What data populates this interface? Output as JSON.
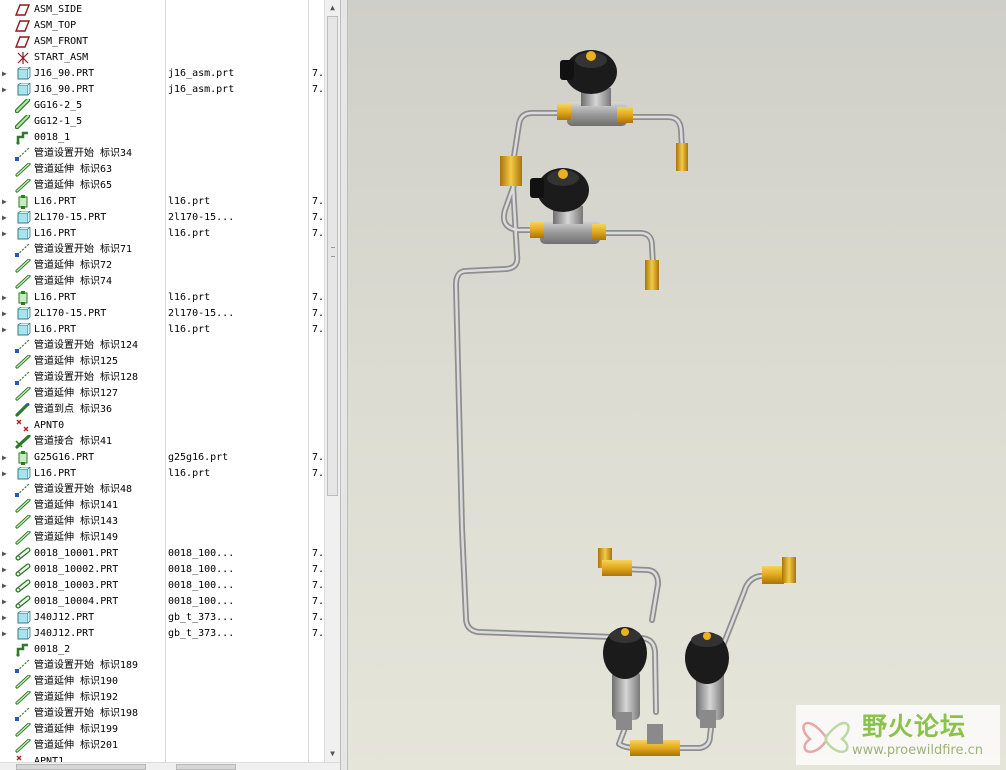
{
  "model_tree": {
    "rows": [
      {
        "name": "ASM_SIDE",
        "file": "",
        "col3": "",
        "icon": "datum-plane-icon",
        "expandable": false
      },
      {
        "name": "ASM_TOP",
        "file": "",
        "col3": "",
        "icon": "datum-plane-icon",
        "expandable": false
      },
      {
        "name": "ASM_FRONT",
        "file": "",
        "col3": "",
        "icon": "datum-plane-icon",
        "expandable": false
      },
      {
        "name": "START_ASM",
        "file": "",
        "col3": "",
        "icon": "coordinate-system-icon",
        "expandable": false
      },
      {
        "name": "J16_90.PRT",
        "file": "j16_asm.prt",
        "col3": "7.",
        "icon": "part-icon",
        "expandable": true
      },
      {
        "name": "J16_90.PRT",
        "file": "j16_asm.prt",
        "col3": "7.",
        "icon": "part-icon",
        "expandable": true
      },
      {
        "name": "GG16-2_5",
        "file": "",
        "col3": "",
        "icon": "pipe-segment-icon",
        "expandable": false
      },
      {
        "name": "GG12-1_5",
        "file": "",
        "col3": "",
        "icon": "pipe-segment-icon",
        "expandable": false
      },
      {
        "name": "0018_1",
        "file": "",
        "col3": "",
        "icon": "pipeline-icon",
        "expandable": false
      },
      {
        "name": "管道设置开始 标识34",
        "file": "",
        "col3": "",
        "icon": "pipe-start-icon",
        "expandable": false
      },
      {
        "name": "管道延伸 标识63",
        "file": "",
        "col3": "",
        "icon": "pipe-extend-icon",
        "expandable": false
      },
      {
        "name": "管道延伸 标识65",
        "file": "",
        "col3": "",
        "icon": "pipe-extend-icon",
        "expandable": false
      },
      {
        "name": "L16.PRT",
        "file": "l16.prt",
        "col3": "7.",
        "icon": "fitting-part-icon",
        "expandable": true
      },
      {
        "name": "2L170-15.PRT",
        "file": "2l170-15...",
        "col3": "7.",
        "icon": "part-icon",
        "expandable": true
      },
      {
        "name": "L16.PRT",
        "file": "l16.prt",
        "col3": "7.",
        "icon": "part-icon",
        "expandable": true
      },
      {
        "name": "管道设置开始 标识71",
        "file": "",
        "col3": "",
        "icon": "pipe-start-icon",
        "expandable": false
      },
      {
        "name": "管道延伸 标识72",
        "file": "",
        "col3": "",
        "icon": "pipe-extend-icon",
        "expandable": false
      },
      {
        "name": "管道延伸 标识74",
        "file": "",
        "col3": "",
        "icon": "pipe-extend-icon",
        "expandable": false
      },
      {
        "name": "L16.PRT",
        "file": "l16.prt",
        "col3": "7.",
        "icon": "fitting-part-icon",
        "expandable": true
      },
      {
        "name": "2L170-15.PRT",
        "file": "2l170-15...",
        "col3": "7.",
        "icon": "part-icon",
        "expandable": true
      },
      {
        "name": "L16.PRT",
        "file": "l16.prt",
        "col3": "7.",
        "icon": "part-icon",
        "expandable": true
      },
      {
        "name": "管道设置开始 标识124",
        "file": "",
        "col3": "",
        "icon": "pipe-start-icon",
        "expandable": false
      },
      {
        "name": "管道延伸 标识125",
        "file": "",
        "col3": "",
        "icon": "pipe-extend-icon",
        "expandable": false
      },
      {
        "name": "管道设置开始 标识128",
        "file": "",
        "col3": "",
        "icon": "pipe-start-icon",
        "expandable": false
      },
      {
        "name": "管道延伸 标识127",
        "file": "",
        "col3": "",
        "icon": "pipe-extend-icon",
        "expandable": false
      },
      {
        "name": "管道到点 标识36",
        "file": "",
        "col3": "",
        "icon": "pipe-to-point-icon",
        "expandable": false
      },
      {
        "name": "APNT0",
        "file": "",
        "col3": "",
        "icon": "datum-point-icon",
        "expandable": false
      },
      {
        "name": "管道接合 标识41",
        "file": "",
        "col3": "",
        "icon": "pipe-join-icon",
        "expandable": false
      },
      {
        "name": "G25G16.PRT",
        "file": "g25g16.prt",
        "col3": "7.",
        "icon": "fitting-part-icon",
        "expandable": true
      },
      {
        "name": "L16.PRT",
        "file": "l16.prt",
        "col3": "7.",
        "icon": "part-icon",
        "expandable": true
      },
      {
        "name": "管道设置开始 标识48",
        "file": "",
        "col3": "",
        "icon": "pipe-start-icon",
        "expandable": false
      },
      {
        "name": "管道延伸 标识141",
        "file": "",
        "col3": "",
        "icon": "pipe-extend-icon",
        "expandable": false
      },
      {
        "name": "管道延伸 标识143",
        "file": "",
        "col3": "",
        "icon": "pipe-extend-icon",
        "expandable": false
      },
      {
        "name": "管道延伸 标识149",
        "file": "",
        "col3": "",
        "icon": "pipe-extend-icon",
        "expandable": false
      },
      {
        "name": "0018_10001.PRT",
        "file": "0018_100...",
        "col3": "7.",
        "icon": "pipe-part-icon",
        "expandable": true
      },
      {
        "name": "0018_10002.PRT",
        "file": "0018_100...",
        "col3": "7.",
        "icon": "pipe-part-icon",
        "expandable": true
      },
      {
        "name": "0018_10003.PRT",
        "file": "0018_100...",
        "col3": "7.",
        "icon": "pipe-part-icon",
        "expandable": true
      },
      {
        "name": "0018_10004.PRT",
        "file": "0018_100...",
        "col3": "7.",
        "icon": "pipe-part-icon",
        "expandable": true
      },
      {
        "name": "J40J12.PRT",
        "file": "gb_t_373...",
        "col3": "7.",
        "icon": "part-icon",
        "expandable": true
      },
      {
        "name": "J40J12.PRT",
        "file": "gb_t_373...",
        "col3": "7.",
        "icon": "part-icon",
        "expandable": true
      },
      {
        "name": "0018_2",
        "file": "",
        "col3": "",
        "icon": "pipeline-icon",
        "expandable": false
      },
      {
        "name": "管道设置开始 标识189",
        "file": "",
        "col3": "",
        "icon": "pipe-start-icon",
        "expandable": false
      },
      {
        "name": "管道延伸 标识190",
        "file": "",
        "col3": "",
        "icon": "pipe-extend-icon",
        "expandable": false
      },
      {
        "name": "管道延伸 标识192",
        "file": "",
        "col3": "",
        "icon": "pipe-extend-icon",
        "expandable": false
      },
      {
        "name": "管道设置开始 标识198",
        "file": "",
        "col3": "",
        "icon": "pipe-start-icon",
        "expandable": false
      },
      {
        "name": "管道延伸 标识199",
        "file": "",
        "col3": "",
        "icon": "pipe-extend-icon",
        "expandable": false
      },
      {
        "name": "管道延伸 标识201",
        "file": "",
        "col3": "",
        "icon": "pipe-extend-icon",
        "expandable": false
      },
      {
        "name": "APNT1",
        "file": "",
        "col3": "",
        "icon": "datum-point-icon",
        "expandable": false
      }
    ]
  },
  "viewport": {
    "model": "piping-assembly-with-4-solenoid-valves",
    "colors": {
      "pipe": "#b9b9b9",
      "fitting": "#e2a81c",
      "coil": "#1a1a1a",
      "valve_body": "#9a9a9a",
      "background_top": "#cfcfc9",
      "background_bottom": "#e6e5da"
    }
  },
  "watermark": {
    "title": "野火论坛",
    "url": "www.proewildfire.cn",
    "logo_icon": "butterfly-logo-icon"
  }
}
